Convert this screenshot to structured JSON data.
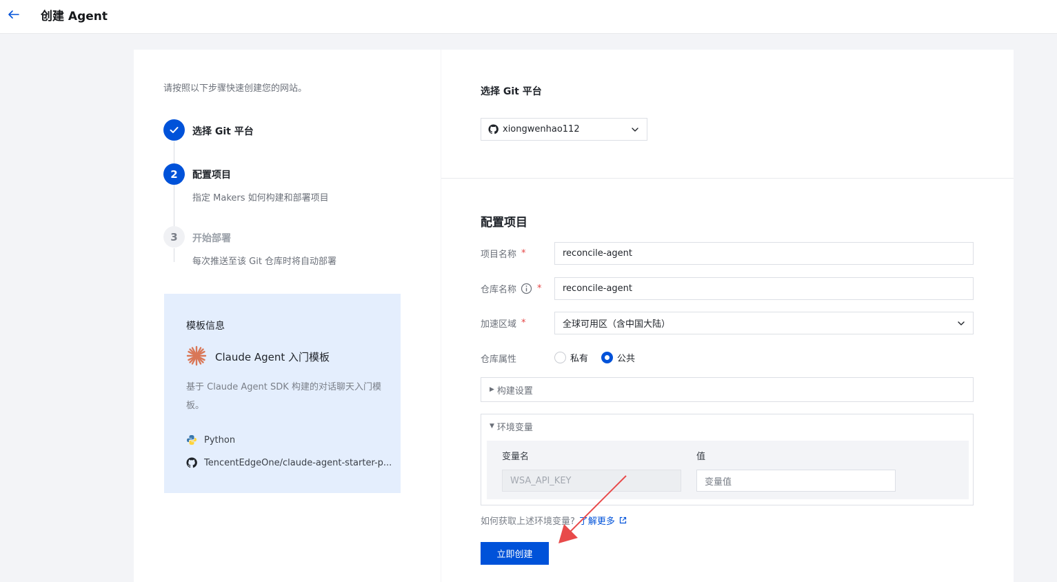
{
  "header": {
    "title": "创建 Agent"
  },
  "wizard": {
    "intro": "请按照以下步骤快速创建您的网站。",
    "steps": [
      {
        "number": "1",
        "title": "选择 Git 平台",
        "desc": "",
        "state": "done"
      },
      {
        "number": "2",
        "title": "配置项目",
        "desc": "指定 Makers 如何构建和部署项目",
        "state": "active"
      },
      {
        "number": "3",
        "title": "开始部署",
        "desc": "每次推送至该 Git 仓库时将自动部署",
        "state": "pending"
      }
    ]
  },
  "template": {
    "heading": "模板信息",
    "name": "Claude Agent 入门模板",
    "description": "基于 Claude Agent SDK 构建的对话聊天入门模板。",
    "language": "Python",
    "repo": "TencentEdgeOne/claude-agent-starter-p..."
  },
  "git": {
    "section_title": "选择 Git 平台",
    "account": "xiongwenhao112"
  },
  "config": {
    "section_title": "配置项目",
    "project_name_label": "项目名称",
    "project_name": "reconcile-agent",
    "repo_name_label": "仓库名称",
    "repo_name": "reconcile-agent",
    "region_label": "加速区域",
    "region": "全球可用区（含中国大陆）",
    "visibility_label": "仓库属性",
    "visibility_options": [
      "私有",
      "公共"
    ],
    "visibility_selected": "公共",
    "required_mark": "*"
  },
  "build": {
    "label": "构建设置"
  },
  "env": {
    "label": "环境变量",
    "col_name": "变量名",
    "col_value": "值",
    "key": "WSA_API_KEY",
    "value_placeholder": "变量值"
  },
  "help": {
    "question": "如何获取上述环境变量?",
    "link": "了解更多"
  },
  "submit": {
    "label": "立即创建"
  },
  "colors": {
    "primary": "#0052d9",
    "arrow": "#e84a4a",
    "card_bg": "#e4eefd"
  }
}
